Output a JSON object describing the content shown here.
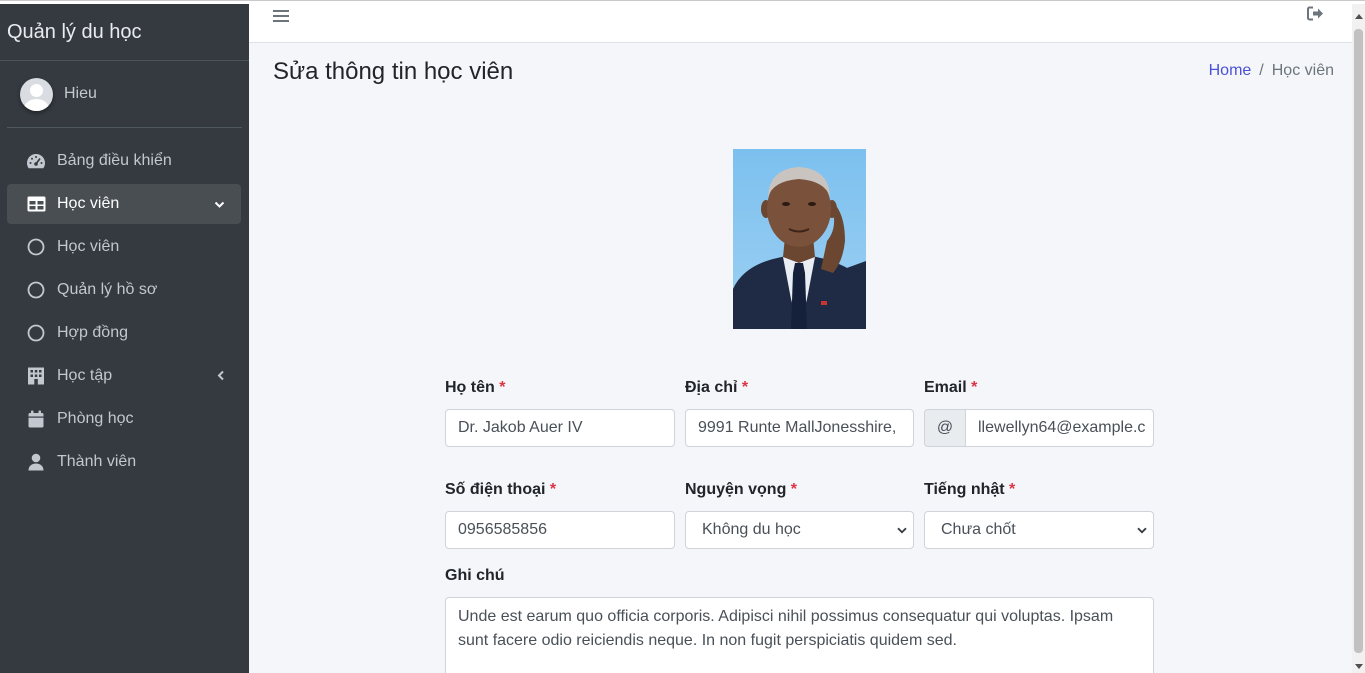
{
  "sidebar": {
    "brand": "Quản lý du học",
    "user_name": "Hieu",
    "items": [
      {
        "label": "Bảng điều khiển",
        "icon": "tachometer-icon"
      },
      {
        "label": "Học viên",
        "icon": "table-icon",
        "active": true
      },
      {
        "label": "Học viên",
        "icon": "circle-icon"
      },
      {
        "label": "Quản lý hồ sơ",
        "icon": "circle-icon"
      },
      {
        "label": "Hợp đồng",
        "icon": "circle-icon"
      },
      {
        "label": "Học tập",
        "icon": "building-icon"
      },
      {
        "label": "Phòng học",
        "icon": "calendar-icon"
      },
      {
        "label": "Thành viên",
        "icon": "user-icon"
      }
    ]
  },
  "header": {
    "title": "Sửa thông tin học viên",
    "breadcrumb": {
      "home": "Home",
      "separator": "/",
      "current": "Học viên"
    }
  },
  "form": {
    "ho_ten": {
      "label": "Họ tên",
      "required": "*",
      "value": "Dr. Jakob Auer IV"
    },
    "dia_chi": {
      "label": "Địa chỉ",
      "required": "*",
      "value": "9991 Runte MallJonesshire,"
    },
    "email": {
      "label": "Email",
      "required": "*",
      "prefix": "@",
      "value": "llewellyn64@example.c"
    },
    "so_dien_thoai": {
      "label": "Số điện thoại",
      "required": "*",
      "value": "0956585856"
    },
    "nguyen_vong": {
      "label": "Nguyện vọng",
      "required": "*",
      "value": "Không du học"
    },
    "tieng_nhat": {
      "label": "Tiếng nhật",
      "required": "*",
      "value": "Chưa chốt"
    },
    "ghi_chu": {
      "label": "Ghi chú",
      "value": "Unde est earum quo officia corporis. Adipisci nihil possimus consequatur qui voluptas. Ipsam sunt facere odio reiciendis neque. In non fugit perspiciatis quidem sed."
    }
  },
  "colors": {
    "sidebar_bg": "#343a40",
    "link": "#4b52d6",
    "required": "#dc3545"
  }
}
